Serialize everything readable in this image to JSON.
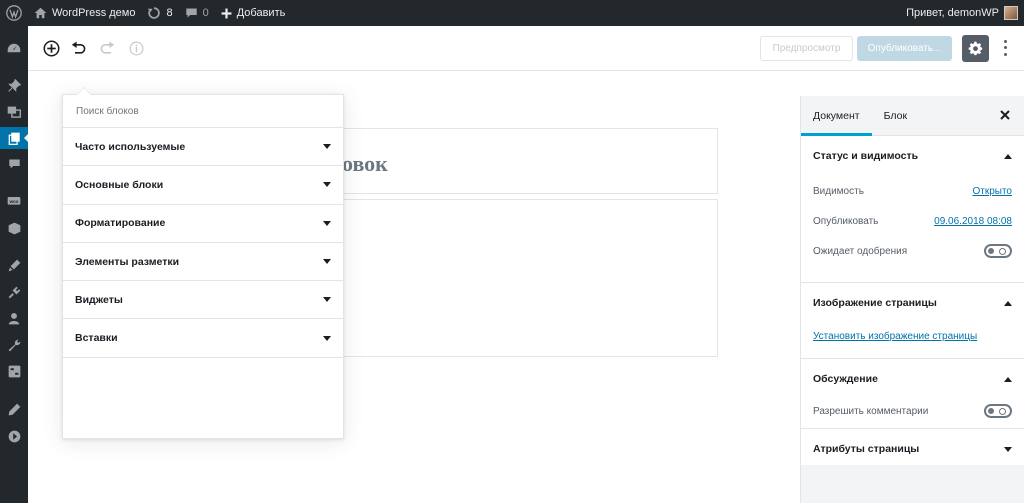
{
  "adminbar": {
    "site_name": "WordPress демо",
    "updates_count": "8",
    "comments_count": "0",
    "add_new": "Добавить",
    "greeting": "Привет, demonWP"
  },
  "toolbar": {
    "preview": "Предпросмотр",
    "publish": "Опубликовать..."
  },
  "editor": {
    "title_fragment": "овок"
  },
  "inserter": {
    "search_placeholder": "Поиск блоков",
    "categories": [
      {
        "label": "Часто используемые"
      },
      {
        "label": "Основные блоки"
      },
      {
        "label": "Форматирование"
      },
      {
        "label": "Элементы разметки"
      },
      {
        "label": "Виджеты"
      },
      {
        "label": "Вставки"
      }
    ]
  },
  "sidebar": {
    "tab_document": "Документ",
    "tab_block": "Блок",
    "status": {
      "title": "Статус и видимость",
      "visibility_label": "Видимость",
      "visibility_value": "Открыто",
      "publish_label": "Опубликовать",
      "publish_value": "09.06.2018 08:08",
      "pending_label": "Ожидает одобрения"
    },
    "featured": {
      "title": "Изображение страницы",
      "link": "Установить изображение страницы"
    },
    "discussion": {
      "title": "Обсуждение",
      "allow_comments": "Разрешить комментарии"
    },
    "attributes": {
      "title": "Атрибуты страницы"
    }
  },
  "colors": {
    "admin_dark": "#23282d",
    "accent": "#0073aa",
    "tab_active": "#00a0d2",
    "publish_disabled": "#bfd8e4"
  },
  "icons": [
    "wordpress-icon",
    "home-icon",
    "updates-icon",
    "comments-icon",
    "plus-icon",
    "dashboard-icon",
    "pin-icon",
    "media-icon",
    "pages-icon",
    "comment-icon",
    "woo-icon",
    "products-icon",
    "appearance-icon",
    "plugins-icon",
    "users-icon",
    "tools-icon",
    "settings-icon",
    "edit-icon",
    "play-icon",
    "add-block-icon",
    "undo-icon",
    "redo-icon",
    "info-icon",
    "gear-icon",
    "more-icon",
    "close-icon"
  ]
}
